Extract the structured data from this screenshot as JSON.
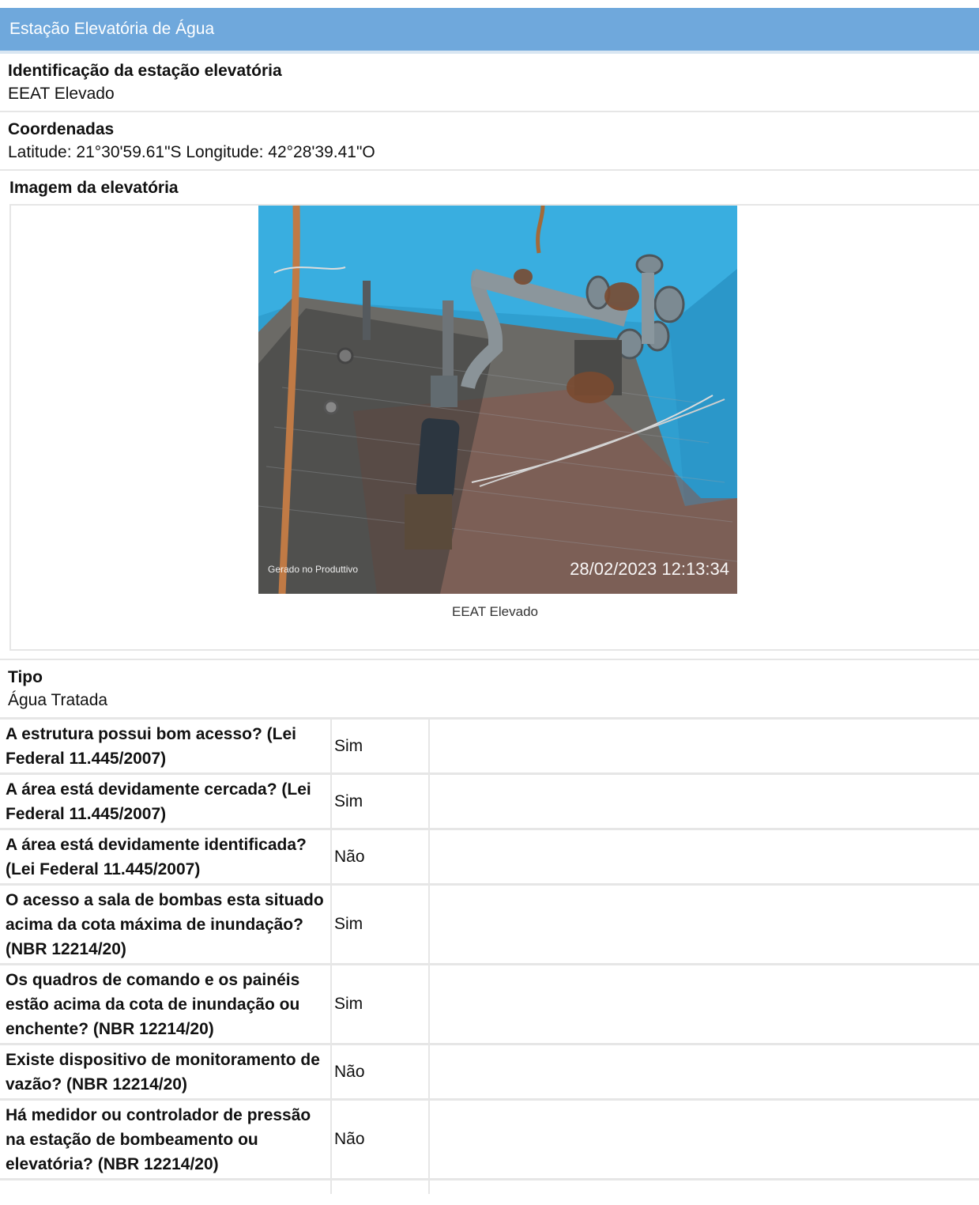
{
  "header": {
    "title": "Estação Elevatória de Água"
  },
  "identificacao": {
    "label": "Identificação da estação elevatória",
    "value": "EEAT Elevado"
  },
  "coordenadas": {
    "label": "Coordenadas",
    "value": "Latitude: 21°30'59.61\"S Longitude: 42°28'39.41\"O"
  },
  "imagem": {
    "label": "Imagem da elevatória",
    "caption": "EEAT Elevado",
    "watermark_left": "Gerado no Produttivo",
    "watermark_right": "28/02/2023 12:13:34"
  },
  "tipo": {
    "label": "Tipo",
    "value": "Água Tratada"
  },
  "questions": [
    {
      "q": "A estrutura possui bom acesso? (Lei Federal 11.445/2007)",
      "a": "Sim"
    },
    {
      "q": "A área está devidamente cercada? (Lei Federal 11.445/2007)",
      "a": "Sim"
    },
    {
      "q": "A área está devidamente identificada? (Lei Federal 11.445/2007)",
      "a": "Não"
    },
    {
      "q": "O acesso a sala de bombas esta situado acima da cota máxima de inundação? (NBR 12214/20)",
      "a": "Sim"
    },
    {
      "q": "Os quadros de comando e os painéis estão acima da cota de inundação ou enchente? (NBR 12214/20)",
      "a": "Sim"
    },
    {
      "q": "Existe dispositivo de monitoramento de vazão? (NBR 12214/20)",
      "a": "Não"
    },
    {
      "q": "Há medidor ou controlador de pressão na estação de bombeamento ou elevatória? (NBR 12214/20)",
      "a": "Não"
    }
  ]
}
